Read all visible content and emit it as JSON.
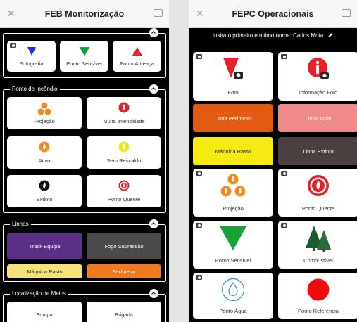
{
  "left": {
    "title": "FEB Monitorização",
    "top_buttons": [
      "Fotografia",
      "Ponto Sensível",
      "Ponto Ameaça"
    ],
    "fire": {
      "title": "Ponto de Incêndio",
      "buttons": [
        "Projeção",
        "Muita Intensidade",
        "Ativo",
        "Sem Rescaldo",
        "Extinto",
        "Ponto Quente"
      ]
    },
    "lines": {
      "title": "Linhas",
      "buttons": [
        "Track Equipa",
        "Fogo Supressão",
        "Máquina Rasto",
        "Perímetro"
      ]
    },
    "resources": {
      "title": "Localização de Meios",
      "buttons": [
        "Equipa",
        "Brigada"
      ]
    }
  },
  "right": {
    "title": "FEPC Operacionais",
    "name_prompt": "Insira o primeiro e último nome: Carlos Mota",
    "tiles": [
      "Foto",
      "Informação Foto",
      "Linha Perímetro",
      "Linha Ativo",
      "Máquina Rasto",
      "Linha Extinto",
      "Projeção",
      "Ponto Quente",
      "Ponto Sensível",
      "Combustível",
      "Ponto Água",
      "Ponto Referência"
    ]
  },
  "colors": {
    "blue": "#1a2ee0",
    "green": "#17a33a",
    "red": "#e8202a",
    "orange": "#f08a1c",
    "yellow": "#f0e620",
    "purple": "#5b2f86",
    "dark_gray": "#4a4a4a",
    "perimeter_orange": "#e35a12",
    "salmon": "#f08a8a",
    "light_yellow": "#f5e37a"
  }
}
